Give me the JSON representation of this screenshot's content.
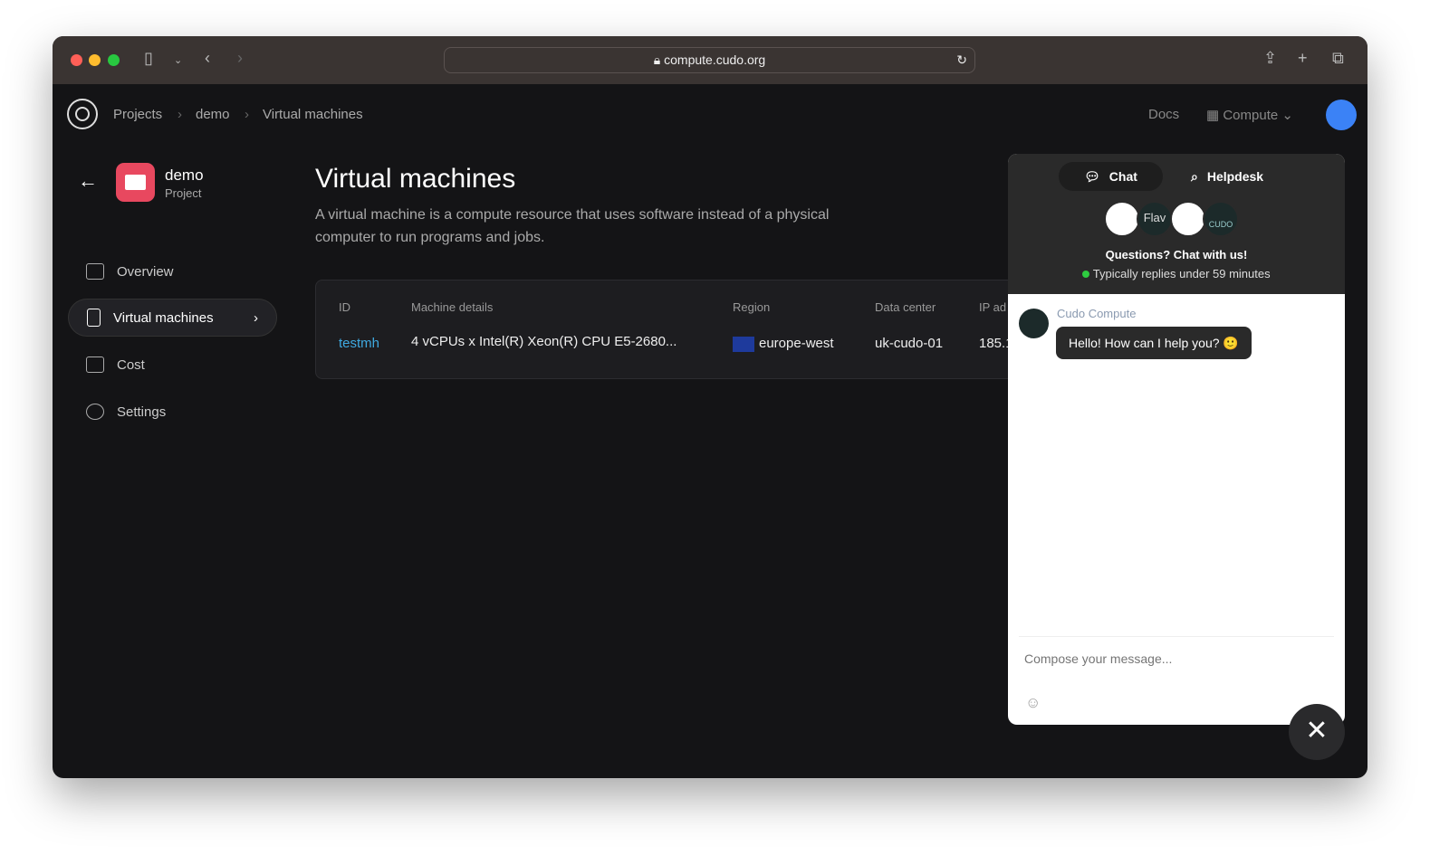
{
  "browser": {
    "url": "compute.cudo.org"
  },
  "breadcrumb": [
    "Projects",
    "demo",
    "Virtual machines"
  ],
  "topnav": {
    "docs": "Docs",
    "compute": "Compute"
  },
  "project": {
    "name": "demo",
    "type": "Project",
    "color": "#e8485f"
  },
  "sidebar": {
    "items": [
      {
        "label": "Overview"
      },
      {
        "label": "Virtual machines",
        "active": true
      },
      {
        "label": "Cost"
      },
      {
        "label": "Settings"
      }
    ]
  },
  "page": {
    "title": "Virtual machines",
    "description_line1": "A virtual machine is a compute resource that uses software instead of a physical",
    "description_line2": "computer to run programs and jobs."
  },
  "table": {
    "headers": [
      "ID",
      "Machine details",
      "Region",
      "Data center",
      "IP ad"
    ],
    "rows": [
      {
        "id": "testmh",
        "details": "4 vCPUs x Intel(R) Xeon(R) CPU E5-2680...",
        "region": "europe-west",
        "datacenter": "uk-cudo-01",
        "ip": "185.1"
      }
    ]
  },
  "chat": {
    "tab_chat": "Chat",
    "tab_helpdesk": "Helpdesk",
    "avatar_label": "Flav",
    "logo_text": "CUDO",
    "headline": "Questions? Chat with us!",
    "reply_time": "Typically replies under 59 minutes",
    "sender": "Cudo Compute",
    "message": "Hello! How can I help you? 🙂",
    "compose_placeholder": "Compose your message...",
    "status_color": "#2ecc40"
  }
}
